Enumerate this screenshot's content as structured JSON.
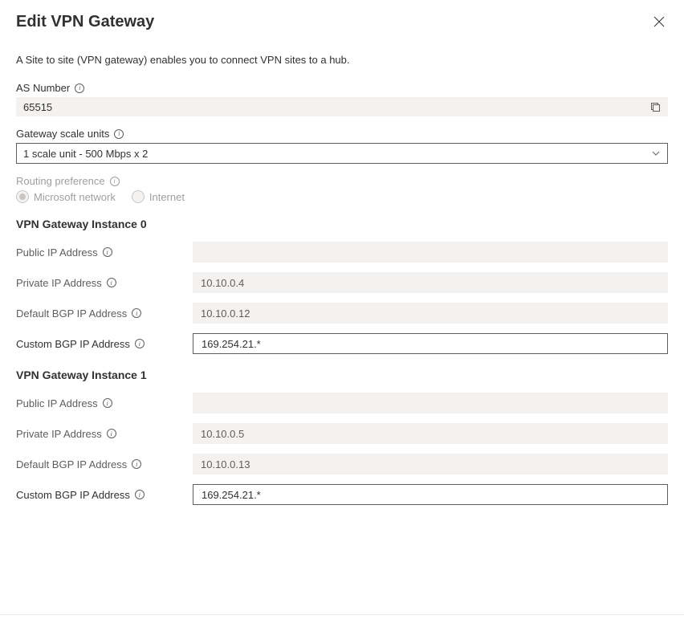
{
  "header": {
    "title": "Edit VPN Gateway"
  },
  "description": "A Site to site (VPN gateway) enables you to connect VPN sites to a hub.",
  "fields": {
    "as_number": {
      "label": "AS Number",
      "value": "65515"
    },
    "gateway_scale": {
      "label": "Gateway scale units",
      "value": "1 scale unit - 500 Mbps x 2"
    },
    "routing_preference": {
      "label": "Routing preference",
      "options": {
        "microsoft": "Microsoft network",
        "internet": "Internet"
      }
    }
  },
  "instances": [
    {
      "title": "VPN Gateway Instance 0",
      "public_ip": {
        "label": "Public IP Address",
        "value": ""
      },
      "private_ip": {
        "label": "Private IP Address",
        "value": "10.10.0.4"
      },
      "default_bgp": {
        "label": "Default BGP IP Address",
        "value": "10.10.0.12"
      },
      "custom_bgp": {
        "label": "Custom BGP IP Address",
        "value": "169.254.21.*"
      }
    },
    {
      "title": "VPN Gateway Instance 1",
      "public_ip": {
        "label": "Public IP Address",
        "value": ""
      },
      "private_ip": {
        "label": "Private IP Address",
        "value": "10.10.0.5"
      },
      "default_bgp": {
        "label": "Default BGP IP Address",
        "value": "10.10.0.13"
      },
      "custom_bgp": {
        "label": "Custom BGP IP Address",
        "value": "169.254.21.*"
      }
    }
  ]
}
